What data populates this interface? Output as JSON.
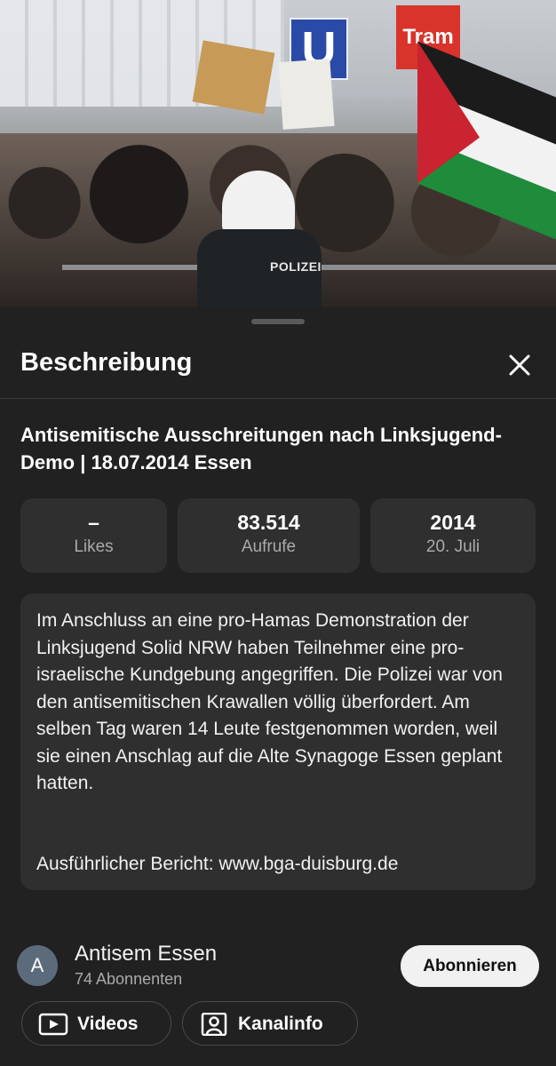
{
  "video": {
    "sign_u": "U",
    "sign_tram": "Tram",
    "officer_label": "POLIZEI"
  },
  "sheet": {
    "title": "Beschreibung",
    "close_icon": "close-icon"
  },
  "video_info": {
    "title": "Antisemitische Ausschreitungen nach Linksjugend-Demo | 18.07.2014 Essen",
    "stats": [
      {
        "value": "–",
        "label": "Likes"
      },
      {
        "value": "83.514",
        "label": "Aufrufe"
      },
      {
        "value": "2014",
        "label": "20. Juli"
      }
    ],
    "description": "Im Anschluss an eine pro-Hamas Demonstration der Linksjugend Solid NRW haben Teilnehmer eine pro-israelische Kundgebung angegriffen. Die Polizei war von den antisemitischen Krawallen völlig überfordert. Am selben Tag waren 14 Leute festgenommen worden, weil sie einen Anschlag auf die Alte Synagoge Essen geplant hatten.",
    "report_link": "Ausführlicher Bericht: www.bga-duisburg.de"
  },
  "channel": {
    "avatar_letter": "A",
    "name": "Antisem Essen",
    "subscribers": "74 Abonnenten",
    "subscribe_label": "Abonnieren",
    "videos_label": "Videos",
    "about_label": "Kanalinfo"
  },
  "colors": {
    "background": "#0f0f0f",
    "sheet": "#212121",
    "card": "#2f2f2f",
    "subscribe_button": "#f1f1f1"
  }
}
